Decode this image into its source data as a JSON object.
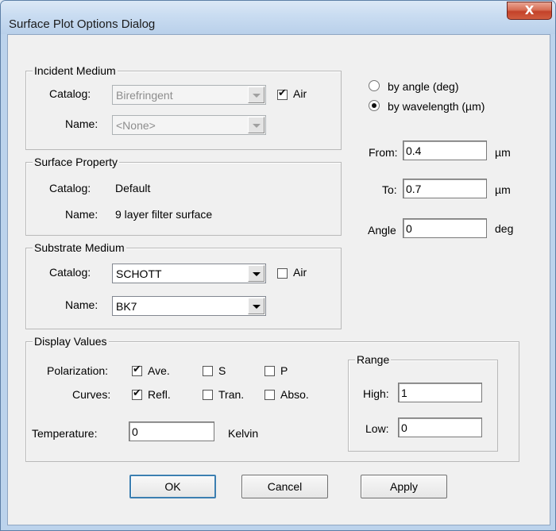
{
  "window": {
    "title": "Surface Plot Options Dialog",
    "close_glyph": "X"
  },
  "incident": {
    "group_label": "Incident Medium",
    "catalog_label": "Catalog:",
    "catalog_value": "Birefringent",
    "air_label": "Air",
    "air_checked": true,
    "name_label": "Name:",
    "name_value": "<None>"
  },
  "surface": {
    "group_label": "Surface Property",
    "catalog_label": "Catalog:",
    "catalog_value": "Default",
    "name_label": "Name:",
    "name_value": "9 layer filter surface"
  },
  "substrate": {
    "group_label": "Substrate Medium",
    "catalog_label": "Catalog:",
    "catalog_value": "SCHOTT",
    "air_label": "Air",
    "air_checked": false,
    "name_label": "Name:",
    "name_value": "BK7"
  },
  "mode": {
    "by_angle": "by angle (deg)",
    "by_wavelength": "by wavelength (µm)",
    "selected": "by_wavelength"
  },
  "range_inputs": {
    "from_label": "From:",
    "from_value": "0.4",
    "from_unit": "µm",
    "to_label": "To:",
    "to_value": "0.7",
    "to_unit": "µm",
    "angle_label": "Angle",
    "angle_value": "0",
    "angle_unit": "deg"
  },
  "display": {
    "group_label": "Display Values",
    "polarization_label": "Polarization:",
    "pol_ave": "Ave.",
    "pol_s": "S",
    "pol_p": "P",
    "curves_label": "Curves:",
    "curve_refl": "Refl.",
    "curve_tran": "Tran.",
    "curve_abso": "Abso.",
    "temperature_label": "Temperature:",
    "temperature_value": "0",
    "temperature_unit": "Kelvin",
    "range_label": "Range",
    "high_label": "High:",
    "high_value": "1",
    "low_label": "Low:",
    "low_value": "0"
  },
  "buttons": {
    "ok": "OK",
    "cancel": "Cancel",
    "apply": "Apply"
  }
}
